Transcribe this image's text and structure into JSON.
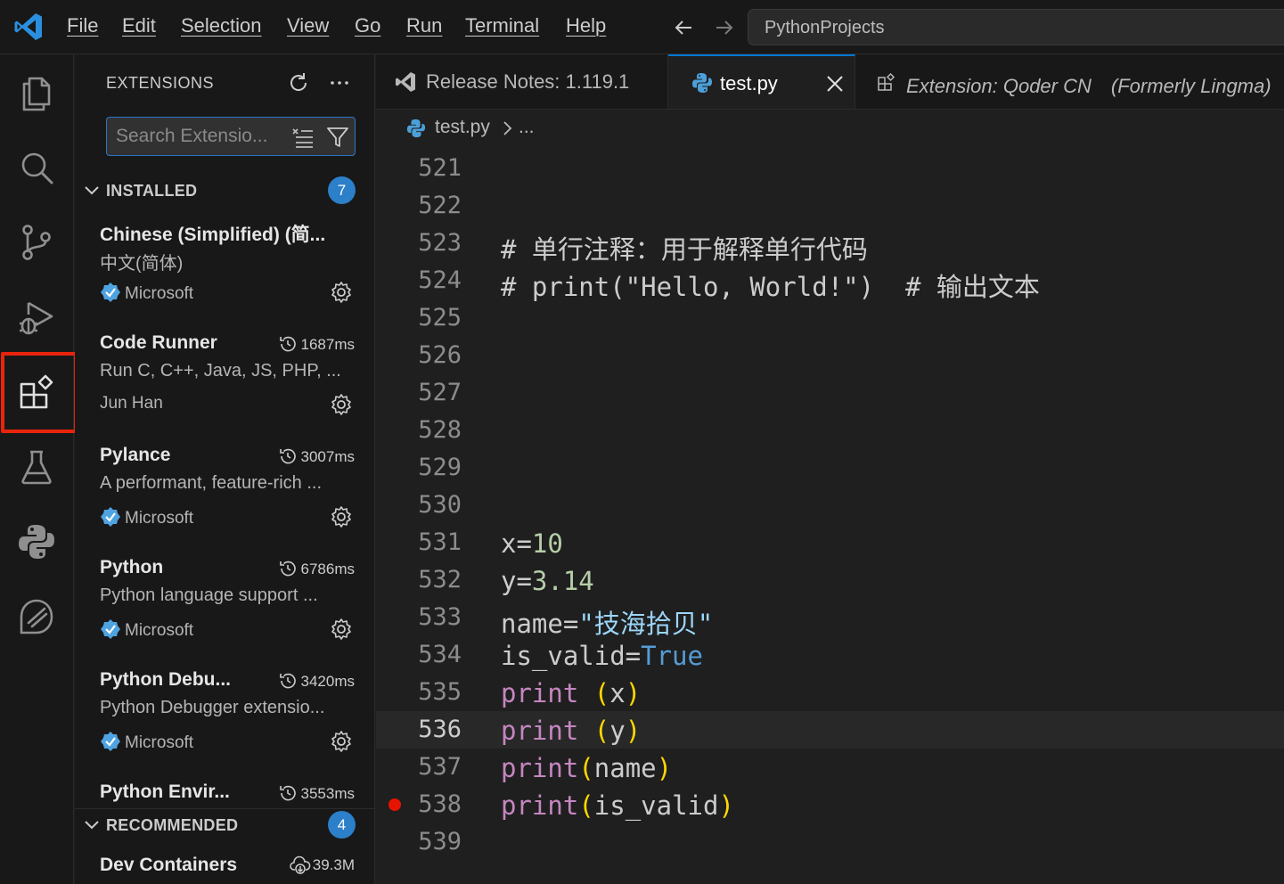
{
  "menu": [
    "File",
    "Edit",
    "Selection",
    "View",
    "Go",
    "Run",
    "Terminal",
    "Help"
  ],
  "command_center": {
    "text": "PythonProjects"
  },
  "activity_bar": {
    "items": [
      "explorer-icon",
      "search-icon",
      "source-control-icon",
      "run-debug-icon",
      "extensions-icon",
      "testing-icon",
      "python-icon",
      "qoder-icon"
    ],
    "active": "extensions-icon",
    "highlight_color": "#e8240c"
  },
  "sidebar": {
    "title": "EXTENSIONS",
    "search": {
      "placeholder": "Search Extensions in Marketplace",
      "display": "Search Extensio..."
    },
    "installed": {
      "label": "INSTALLED",
      "count": "7",
      "items": [
        {
          "name": "Chinese (Simplified) (简...",
          "desc": "中文(简体)",
          "publisher": "Microsoft",
          "verified": true,
          "timing": ""
        },
        {
          "name": "Code Runner",
          "desc": "Run C, C++, Java, JS, PHP, ...",
          "publisher": "Jun Han",
          "verified": false,
          "timing": "1687ms"
        },
        {
          "name": "Pylance",
          "desc": "A performant, feature-rich ...",
          "publisher": "Microsoft",
          "verified": true,
          "timing": "3007ms"
        },
        {
          "name": "Python",
          "desc": "Python language support ...",
          "publisher": "Microsoft",
          "verified": true,
          "timing": "6786ms"
        },
        {
          "name": "Python Debu...",
          "desc": "Python Debugger extensio...",
          "publisher": "Microsoft",
          "verified": true,
          "timing": "3420ms"
        },
        {
          "name": "Python Envir...",
          "desc": "",
          "publisher": "",
          "verified": false,
          "timing": "3553ms"
        }
      ]
    },
    "recommended": {
      "label": "RECOMMENDED",
      "count": "4",
      "items": [
        {
          "name": "Dev Containers",
          "downloads": "39.3M"
        }
      ]
    }
  },
  "tabs": [
    {
      "label": "Release Notes: 1.119.1",
      "active": false
    },
    {
      "label": "test.py",
      "active": true
    },
    {
      "label": "Extension: Qoder CN　(Formerly Lingma)",
      "active": false
    }
  ],
  "breadcrumb": {
    "file": "test.py",
    "more": "..."
  },
  "editor": {
    "current_line": "536",
    "breakpoint_line": "538",
    "lines": [
      {
        "n": "521",
        "code": ""
      },
      {
        "n": "522",
        "code": ""
      },
      {
        "n": "523",
        "code": "# 单行注释：用于解释单行代码"
      },
      {
        "n": "524",
        "code": "# print(\"Hello, World!\")  # 输出文本"
      },
      {
        "n": "525",
        "code": ""
      },
      {
        "n": "526",
        "code": ""
      },
      {
        "n": "527",
        "code": ""
      },
      {
        "n": "528",
        "code": ""
      },
      {
        "n": "529",
        "code": ""
      },
      {
        "n": "530",
        "code": ""
      },
      {
        "n": "531",
        "code": "x=10"
      },
      {
        "n": "532",
        "code": "y=3.14"
      },
      {
        "n": "533",
        "code": "name=\"技海拾贝\""
      },
      {
        "n": "534",
        "code": "is_valid=True"
      },
      {
        "n": "535",
        "code": "print (x)"
      },
      {
        "n": "536",
        "code": "print (y)"
      },
      {
        "n": "537",
        "code": "print(name)"
      },
      {
        "n": "538",
        "code": "print(is_valid)"
      },
      {
        "n": "539",
        "code": ""
      }
    ],
    "tokens": {
      "l531": [
        "x=",
        "10"
      ],
      "l532": [
        "y=",
        "3.14"
      ],
      "l533": [
        "name=",
        "\"技海拾贝\""
      ],
      "l534": [
        "is_valid=",
        "True"
      ],
      "l535": [
        "print",
        " ",
        "(",
        "x",
        ")"
      ],
      "l536": [
        "print",
        " ",
        "(",
        "y",
        ")"
      ],
      "l537": [
        "print",
        "(",
        "name",
        ")"
      ],
      "l538": [
        "print",
        "(",
        "is_valid",
        ")"
      ]
    }
  }
}
